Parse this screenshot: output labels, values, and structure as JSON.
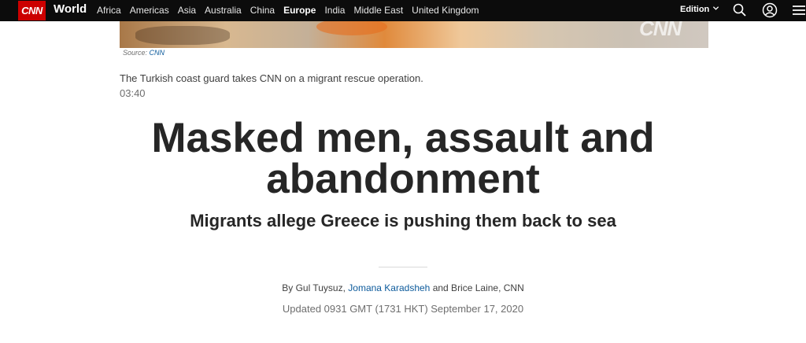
{
  "nav": {
    "logo": "CNN",
    "section": "World",
    "links": [
      "Africa",
      "Americas",
      "Asia",
      "Australia",
      "China",
      "Europe",
      "India",
      "Middle East",
      "United Kingdom"
    ],
    "active_link": "Europe",
    "edition_label": "Edition",
    "icons": [
      "chevron-down-icon",
      "search-icon",
      "account-icon",
      "menu-icon"
    ]
  },
  "media": {
    "source_prefix": "Source:",
    "source_name": "CNN",
    "watermark": "CNN",
    "caption": "The Turkish coast guard takes CNN on a migrant rescue operation.",
    "duration": "03:40"
  },
  "article": {
    "headline": "Masked men, assault and abandonment",
    "subheadline": "Migrants allege Greece is pushing them back to sea",
    "byline_prefix": "By Gul Tuysuz,",
    "byline_link": "Jomana Karadsheh",
    "byline_suffix": "and Brice Laine, CNN",
    "updated": "Updated 0931 GMT (1731 HKT) September 17, 2020"
  },
  "colors": {
    "nav_bg": "#0c0c0c",
    "brand_red": "#cc0000",
    "link_blue": "#0c5a9b",
    "text": "#262626"
  }
}
